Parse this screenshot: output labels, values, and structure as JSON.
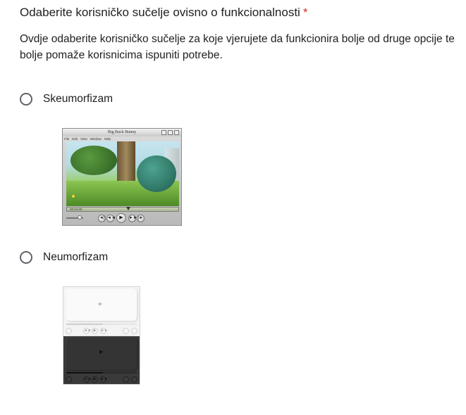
{
  "question": {
    "title": "Odaberite korisničko sučelje ovisno o funkcionalnosti",
    "required_mark": "*",
    "description": "Ovdje odaberite korisničko sučelje za koje vjerujete da funkcionira bolje od druge opcije te bolje pomaže korisnicima ispuniti potrebe."
  },
  "options": [
    {
      "label": "Skeumorfizam",
      "selected": false,
      "image": {
        "type": "quicktime-player-screenshot",
        "window_title": "Big Buck Bunny",
        "menu": [
          "File",
          "Edit",
          "View",
          "Window",
          "Help"
        ],
        "time": "00:04:00",
        "controls": [
          "◄|",
          "◄◄",
          "▶",
          "►►",
          "|►"
        ]
      }
    },
    {
      "label": "Neumorfizam",
      "selected": false,
      "image": {
        "type": "neumorphic-player-mockup",
        "variants": [
          "light",
          "dark"
        ],
        "controls": [
          "◄◄",
          "▶",
          "►►"
        ]
      }
    }
  ],
  "colors": {
    "required": "#d93025",
    "text": "#202124",
    "radio_border": "#5f6368"
  }
}
